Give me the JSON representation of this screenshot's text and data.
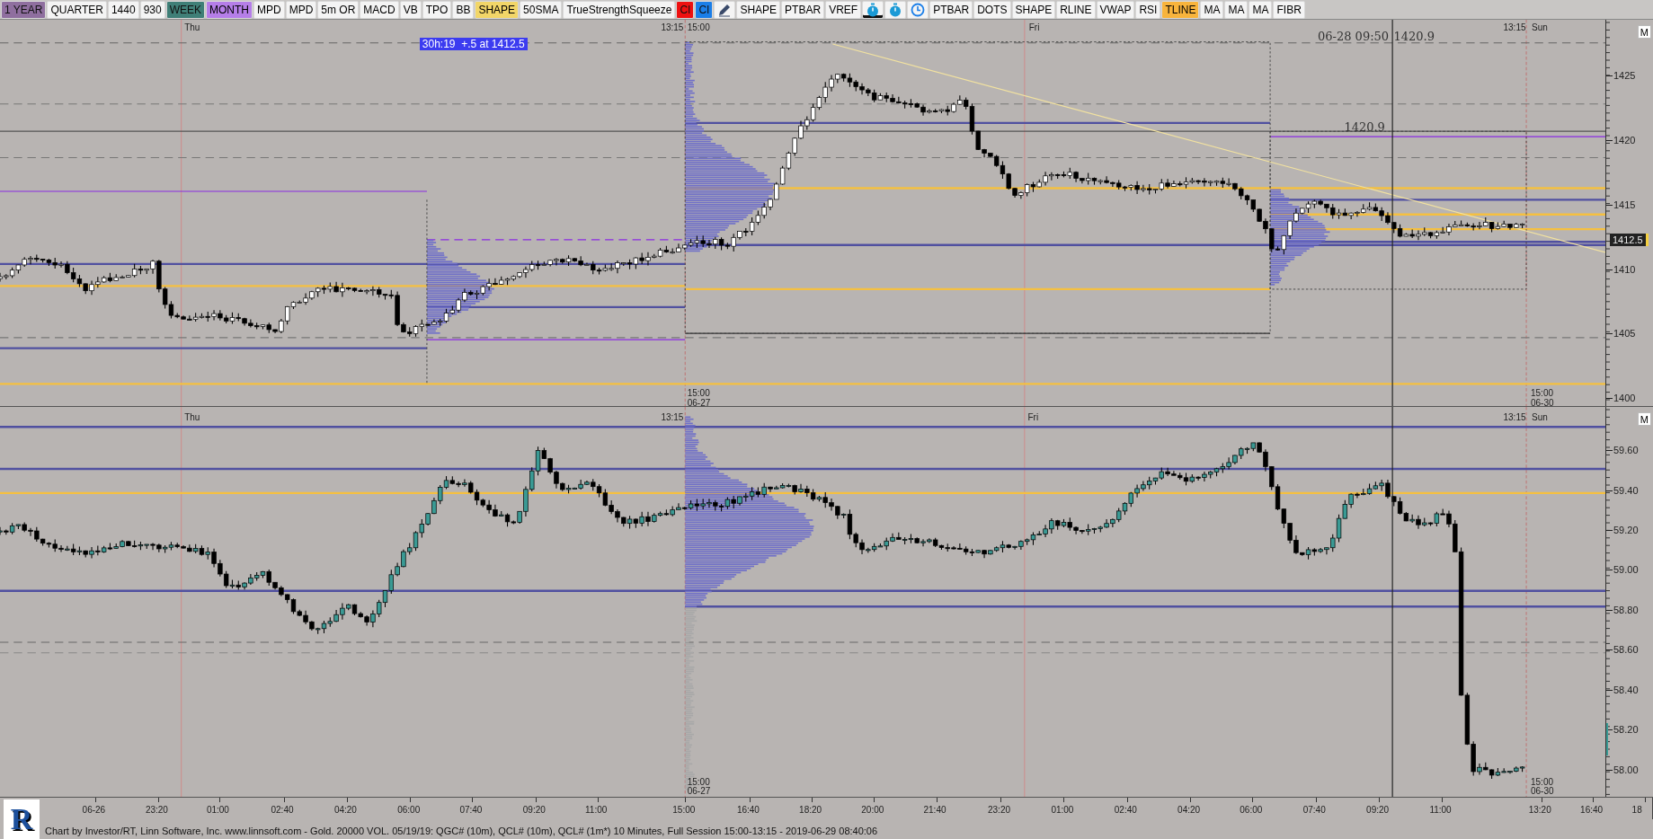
{
  "toolbar": [
    {
      "kind": "text",
      "label": "1 YEAR",
      "color": "#8f6f9f",
      "selected": false
    },
    {
      "kind": "text",
      "label": "QUARTER",
      "color": "#f4f4f4",
      "selected": false
    },
    {
      "kind": "text",
      "label": "1440",
      "color": "#f4f4f4",
      "selected": false
    },
    {
      "kind": "text",
      "label": "930",
      "color": "#f4f4f4",
      "selected": false
    },
    {
      "kind": "text",
      "label": "WEEK",
      "color": "#3f7f77",
      "selected": false
    },
    {
      "kind": "text",
      "label": "MONTH",
      "color": "#b57ee8",
      "selected": false
    },
    {
      "kind": "text",
      "label": "MPD",
      "color": "#f4f4f4",
      "selected": false
    },
    {
      "kind": "text",
      "label": "MPD",
      "color": "#f4f4f4",
      "selected": false
    },
    {
      "kind": "text",
      "label": "5m OR",
      "color": "#f4f4f4",
      "selected": false
    },
    {
      "kind": "text",
      "label": "MACD",
      "color": "#f4f4f4",
      "selected": false
    },
    {
      "kind": "text",
      "label": "VB",
      "color": "#f4f4f4",
      "selected": false
    },
    {
      "kind": "text",
      "label": "TPO",
      "color": "#f4f4f4",
      "selected": false
    },
    {
      "kind": "text",
      "label": "BB",
      "color": "#f4f4f4",
      "selected": false
    },
    {
      "kind": "text",
      "label": "SHAPE",
      "color": "#f2d668",
      "selected": false
    },
    {
      "kind": "text",
      "label": "50SMA",
      "color": "#f4f4f4",
      "selected": false
    },
    {
      "kind": "text",
      "label": "TrueStrengthSqueeze",
      "color": "#f4f4f4",
      "selected": false
    },
    {
      "kind": "text",
      "label": "CI",
      "color": "#ee1111",
      "selected": false
    },
    {
      "kind": "text",
      "label": "CI",
      "color": "#1a7ee8",
      "selected": false
    },
    {
      "kind": "pencil",
      "selected": false
    },
    {
      "kind": "text",
      "label": "SHAPE",
      "color": "#f4f4f4",
      "selected": false
    },
    {
      "kind": "text",
      "label": "PTBAR",
      "color": "#f4f4f4",
      "selected": false
    },
    {
      "kind": "text",
      "label": "VREF",
      "color": "#f4f4f4",
      "selected": false
    },
    {
      "kind": "stopwatch",
      "selected": true
    },
    {
      "kind": "stopwatch",
      "selected": false
    },
    {
      "kind": "clock",
      "selected": false
    },
    {
      "kind": "text",
      "label": "PTBAR",
      "color": "#f4f4f4",
      "selected": false
    },
    {
      "kind": "text",
      "label": "DOTS",
      "color": "#f4f4f4",
      "selected": false
    },
    {
      "kind": "text",
      "label": "SHAPE",
      "color": "#f4f4f4",
      "selected": false
    },
    {
      "kind": "text",
      "label": "RLINE",
      "color": "#f4f4f4",
      "selected": false
    },
    {
      "kind": "text",
      "label": "VWAP",
      "color": "#f4f4f4",
      "selected": false
    },
    {
      "kind": "text",
      "label": "RSI",
      "color": "#f4f4f4",
      "selected": false
    },
    {
      "kind": "text",
      "label": "TLINE",
      "color": "#f8b43c",
      "selected": false
    },
    {
      "kind": "text",
      "label": "MA",
      "color": "#f4f4f4",
      "selected": false
    },
    {
      "kind": "text",
      "label": "MA",
      "color": "#f4f4f4",
      "selected": false
    },
    {
      "kind": "text",
      "label": "MA",
      "color": "#f4f4f4",
      "selected": false
    },
    {
      "kind": "text",
      "label": "FIBR",
      "color": "#f4f4f4",
      "selected": false
    }
  ],
  "panes": [
    {
      "session_labels": [
        "Thu",
        "13:15",
        "15:00",
        "Fri",
        "13:15",
        "Sun"
      ],
      "notes": [
        "06-28 09:50",
        "1420.9",
        "1420.9"
      ],
      "timer_label": "30h:19  +.5 at 1412.5",
      "bottom_labels": [
        "15:00",
        "06-27",
        "15:00",
        "06-30"
      ],
      "y_ticks": [
        "1425",
        "1420",
        "1415",
        "1410",
        "1405",
        "1400"
      ],
      "current_price": "1412.5",
      "m_button": "M"
    },
    {
      "session_labels": [
        "Thu",
        "13:15",
        "Fri",
        "13:15",
        "Sun"
      ],
      "bottom_labels": [
        "15:00",
        "06-27",
        "15:00",
        "06-30"
      ],
      "y_ticks": [
        "59.60",
        "59.40",
        "59.20",
        "59.00",
        "58.80",
        "58.60",
        "58.40",
        "58.20",
        "58.00"
      ],
      "m_button": "M"
    }
  ],
  "time_axis": [
    "06-26",
    "23:20",
    "01:00",
    "02:40",
    "04:20",
    "06:00",
    "07:40",
    "09:20",
    "11:00",
    "15:00",
    "16:40",
    "18:20",
    "20:00",
    "21:40",
    "23:20",
    "01:00",
    "02:40",
    "04:20",
    "06:00",
    "07:40",
    "09:20",
    "11:00",
    "13:20",
    "16:40",
    "18"
  ],
  "logo": "R",
  "status_bar": "Chart by Investor/RT, Linn Software, Inc. www.linnsoft.com - Gold. 20000 VOL.  05/19/19: QGC# (10m), QCL# (10m), QCL# (1m*) 10 Minutes, Full Session 15:00-13:15 - 2019-06-29 08:40:06"
}
